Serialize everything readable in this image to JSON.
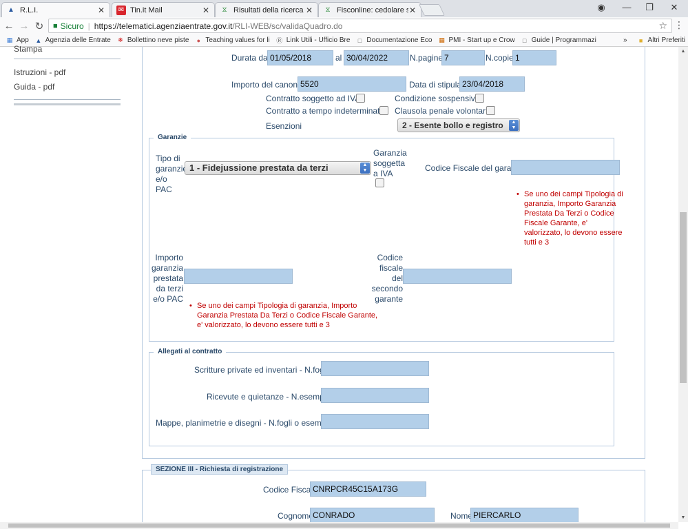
{
  "browser": {
    "tabs": [
      {
        "title": "R.L.I.",
        "icon": "agenzia-entrate-icon",
        "active": true
      },
      {
        "title": "Tin.it Mail",
        "icon": "tin-mail-icon"
      },
      {
        "title": "Risultati della ricerca per",
        "icon": "fisconline-icon"
      },
      {
        "title": "Fisconline: cedolare secc",
        "icon": "fisconline-icon"
      }
    ],
    "security": "Sicuro",
    "url_host": "https://telematici.agenziaentrate.gov.it",
    "url_path": "/RLI-WEB/sc/validaQuadro.do",
    "bookmarks": [
      "App",
      "Agenzia delle Entrate",
      "Bollettino neve piste",
      "Teaching values for li",
      "Link Utili - Ufficio Bre",
      "Documentazione Eco",
      "PMI - Start up e Crow",
      "Guide | Programmazi"
    ],
    "more_bookmarks": "»",
    "other_bookmarks": "Altri Preferiti"
  },
  "sidebar": {
    "cut_item": "Stampa",
    "links": [
      "Istruzioni - pdf",
      "Guida - pdf"
    ]
  },
  "contract": {
    "durata_label": "Durata dal",
    "durata_dal": "01/05/2018",
    "al_label": "al",
    "al_value": "30/04/2022",
    "npagine_label": "N.pagine",
    "npagine": "7",
    "ncopie_label": "N.copie",
    "ncopie": "1",
    "canone_label": "Importo del canone",
    "canone": "5520",
    "stipula_label": "Data di stipula",
    "stipula": "23/04/2018",
    "iva_label": "Contratto soggetto ad IVA",
    "sospensiva_label": "Condizione sospensiva",
    "indeterminato_label": "Contratto a tempo indeterminato",
    "penale_label": "Clausola penale volontaria",
    "esenzioni_label": "Esenzioni",
    "esenzioni_value": "2 - Esente bollo e registro"
  },
  "garanzie": {
    "legend": "Garanzie",
    "tipo_label": "Tipo di garanzie e/o PAC",
    "tipo_value": "1 - Fidejussione prestata da terzi",
    "iva_label": "Garanzia soggetta a IVA",
    "cf_label": "Codice Fiscale del garante",
    "err1": "Se uno dei campi Tipologia di garanzia, Importo Garanzia Prestata Da Terzi o Codice Fiscale Garante, e' valorizzato, lo devono essere tutti e 3",
    "importo_label": "Importo garanzia prestata da terzi e/o PAC",
    "cf2_label": "Codice fiscale del secondo garante",
    "err2": "Se uno dei campi Tipologia di garanzia, Importo Garanzia Prestata Da Terzi o Codice Fiscale Garante, e' valorizzato, lo devono essere tutti e 3"
  },
  "allegati": {
    "legend": "Allegati al contratto",
    "scritture_label": "Scritture private ed inventari - N.fogli",
    "ricevute_label": "Ricevute e quietanze - N.esemplari",
    "mappe_label": "Mappe, planimetrie e disegni - N.fogli o esemplari"
  },
  "sezione3": {
    "legend": "SEZIONE III - Richiesta di registrazione",
    "cf_label": "Codice Fiscale",
    "cf_value": "CNRPCR45C15A173G",
    "cognome_label": "Cognome",
    "cognome_value": "CONRADO",
    "nome_label": "Nome",
    "nome_value": "PIERCARLO"
  }
}
